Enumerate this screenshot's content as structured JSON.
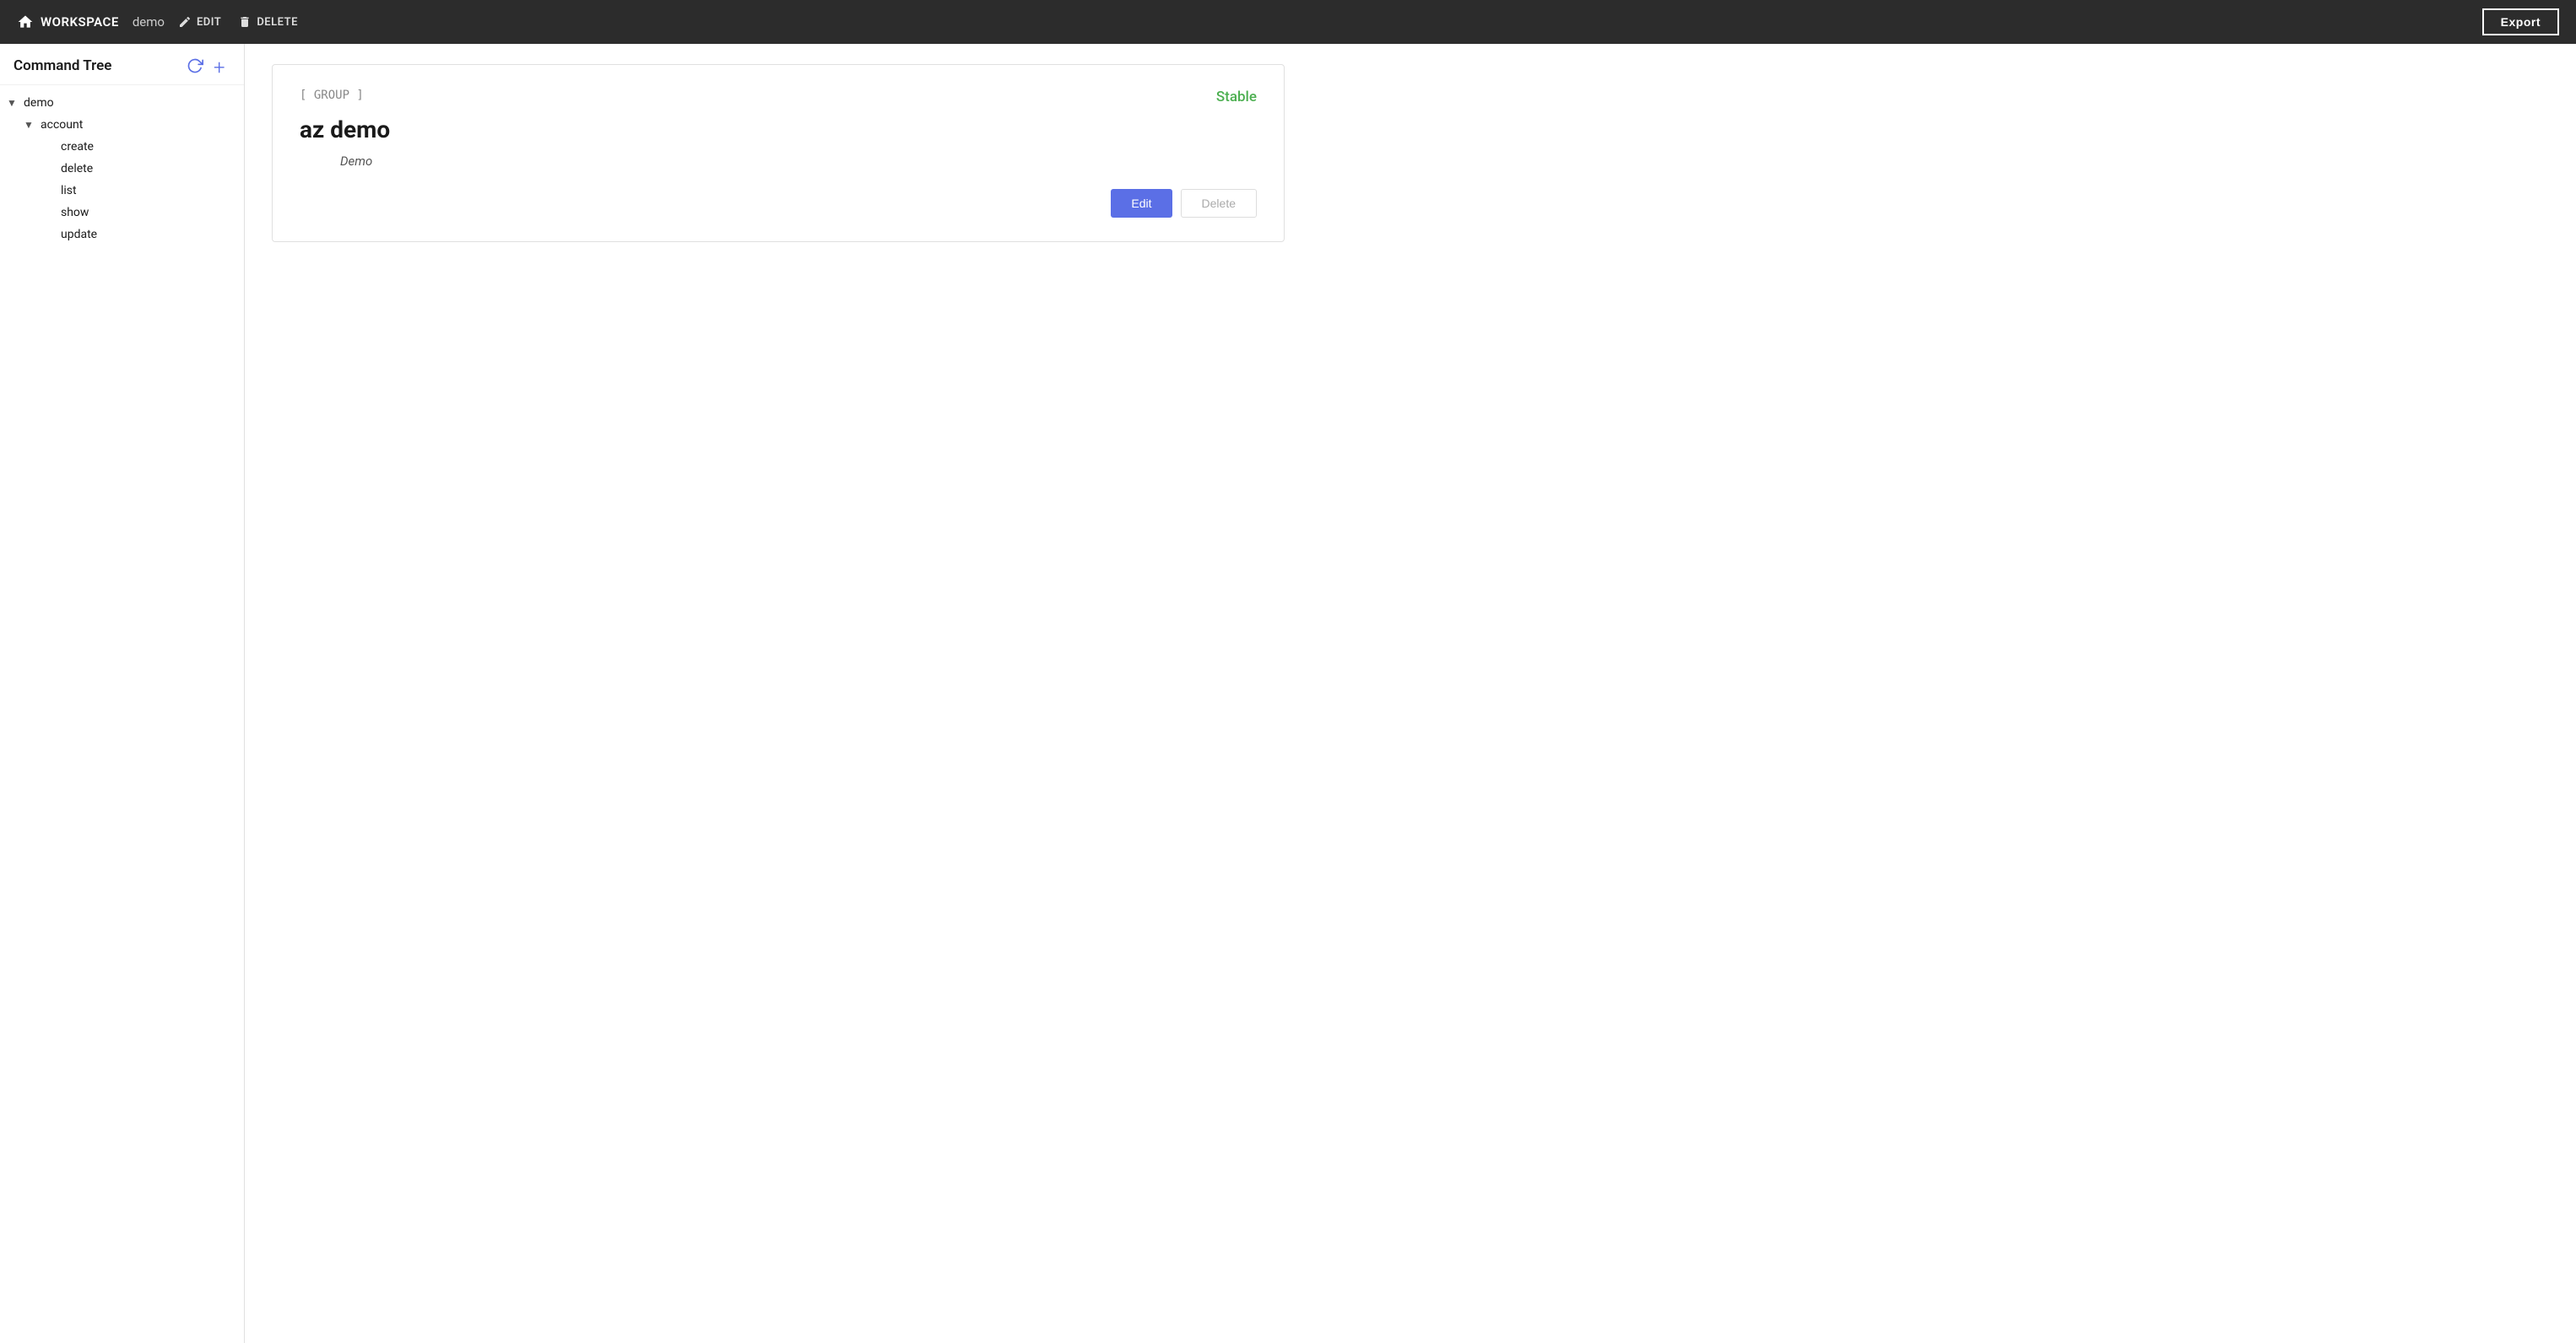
{
  "navbar": {
    "workspace_label": "WORKSPACE",
    "demo_label": "demo",
    "edit_label": "EDIT",
    "delete_label": "DELETE",
    "export_label": "Export"
  },
  "sidebar": {
    "title": "Command Tree",
    "tree": {
      "root": {
        "label": "demo",
        "expanded": true,
        "children": [
          {
            "label": "account",
            "expanded": true,
            "children": [
              {
                "label": "create"
              },
              {
                "label": "delete"
              },
              {
                "label": "list"
              },
              {
                "label": "show"
              },
              {
                "label": "update"
              }
            ]
          }
        ]
      }
    }
  },
  "detail": {
    "tag": "[ GROUP ]",
    "status": "Stable",
    "title": "az demo",
    "description": "Demo",
    "edit_label": "Edit",
    "delete_label": "Delete"
  }
}
